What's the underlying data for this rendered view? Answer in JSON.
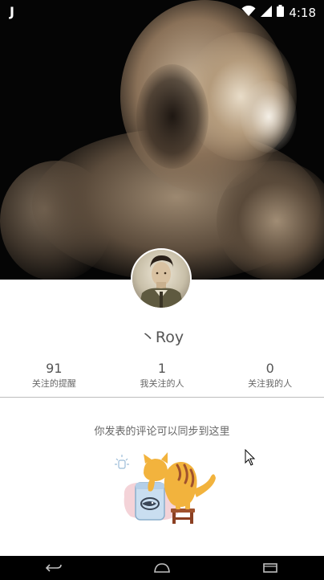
{
  "status_bar": {
    "notification_icon": "j-app-icon",
    "time": "4:18",
    "icons": [
      "wifi-icon",
      "signal-icon",
      "battery-icon"
    ]
  },
  "profile": {
    "cover_image": "blurred-portrait-photo",
    "avatar": "user-avatar-photo",
    "username": "丶Roy",
    "stats": [
      {
        "count": "91",
        "label": "关注的提醒"
      },
      {
        "count": "1",
        "label": "我关注的人"
      },
      {
        "count": "0",
        "label": "关注我的人"
      }
    ]
  },
  "content": {
    "empty_message": "你发表的评论可以同步到这里",
    "illustration": "cat-fishbowl-illustration"
  },
  "nav_bar": {
    "buttons": [
      "back-icon",
      "home-icon",
      "recents-icon"
    ]
  },
  "colors": {
    "text_primary": "#555555",
    "text_secondary": "#666666",
    "divider": "#bdbdbd",
    "cat_orange": "#f2b33d",
    "bowl_blue": "#c9def0",
    "shadow_pink": "#f4d3d8"
  }
}
